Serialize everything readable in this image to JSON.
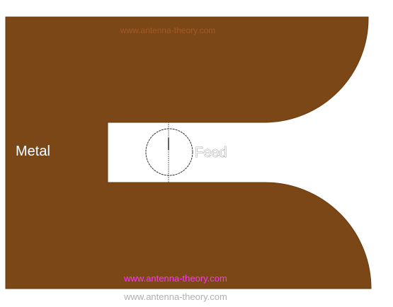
{
  "diagram": {
    "watermark_top": "www.antenna-theory.com",
    "metal_label": "Metal",
    "feed_label": "Feed",
    "watermark_bottom_magenta": "www.antenna-theory.com",
    "watermark_bottom_gray": "www.antenna-theory.com"
  },
  "colors": {
    "metal": "#7b4716",
    "slot": "#ffffff",
    "watermark_top": "#a05a28",
    "watermark_magenta": "#ff33ff",
    "watermark_gray": "#b0b0b0"
  }
}
